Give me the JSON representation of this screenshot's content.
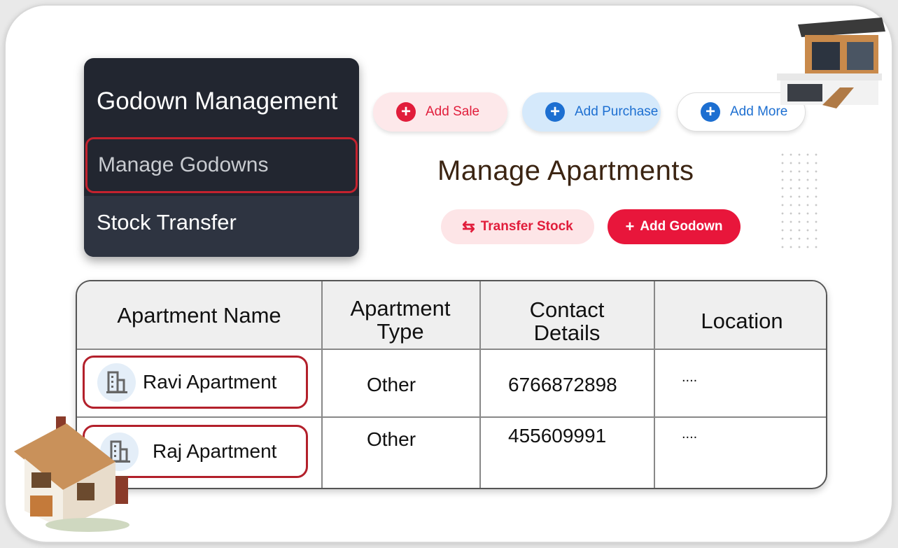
{
  "menu": {
    "title": "Godown Management",
    "items": [
      {
        "label": "Manage Godowns",
        "highlighted": true
      },
      {
        "label": "Stock Transfer"
      }
    ]
  },
  "actions": {
    "add_sale": "Add Sale",
    "add_purchase": "Add Purchase",
    "add_more": "Add More"
  },
  "page": {
    "title": "Manage Apartments",
    "transfer_stock": "Transfer Stock",
    "add_godown": "Add Godown"
  },
  "table": {
    "headers": [
      "Apartment Name",
      "Apartment Type",
      "Contact Details",
      "Location"
    ],
    "rows": [
      {
        "name": "Ravi Apartment",
        "type": "Other",
        "contact": "6766872898",
        "location": "...."
      },
      {
        "name": "Raj Apartment",
        "type": "Other",
        "contact": "455609991",
        "location": "...."
      }
    ]
  },
  "colors": {
    "accent_red": "#e11d3b",
    "accent_blue": "#1d6fd1",
    "menu_bg": "#222630",
    "highlight": "#c4222e"
  }
}
